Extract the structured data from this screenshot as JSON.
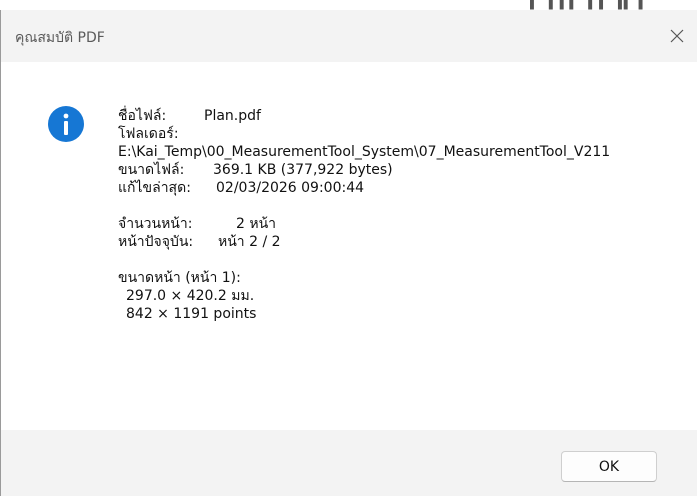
{
  "dialog": {
    "title": "คุณสมบัติ PDF",
    "close_icon": "close-icon",
    "info_icon": "info-icon",
    "info_icon_color": "#1677d4"
  },
  "file": {
    "name_label": "ชื่อไฟล์:",
    "name_value": "Plan.pdf",
    "folder_label": "โฟลเดอร์:",
    "folder_value": "E:\\Kai_Temp\\00_MeasurementTool_System\\07_MeasurementTool_V211",
    "size_label": "ขนาดไฟล์:",
    "size_value": "369.1 KB  (377,922 bytes)",
    "modified_label": "แก้ไขล่าสุด:",
    "modified_value": "02/03/2026 09:00:44"
  },
  "pages": {
    "count_label": "จำนวนหน้า:",
    "count_value": "2 หน้า",
    "current_label": "หน้าปัจจุบัน:",
    "current_value": "หน้า 2 / 2"
  },
  "page_size": {
    "label": "ขนาดหน้า (หน้า 1):",
    "mm_value": "297.0 × 420.2 มม.",
    "points_value": "842 × 1191 points"
  },
  "footer": {
    "ok_label": "OK"
  }
}
